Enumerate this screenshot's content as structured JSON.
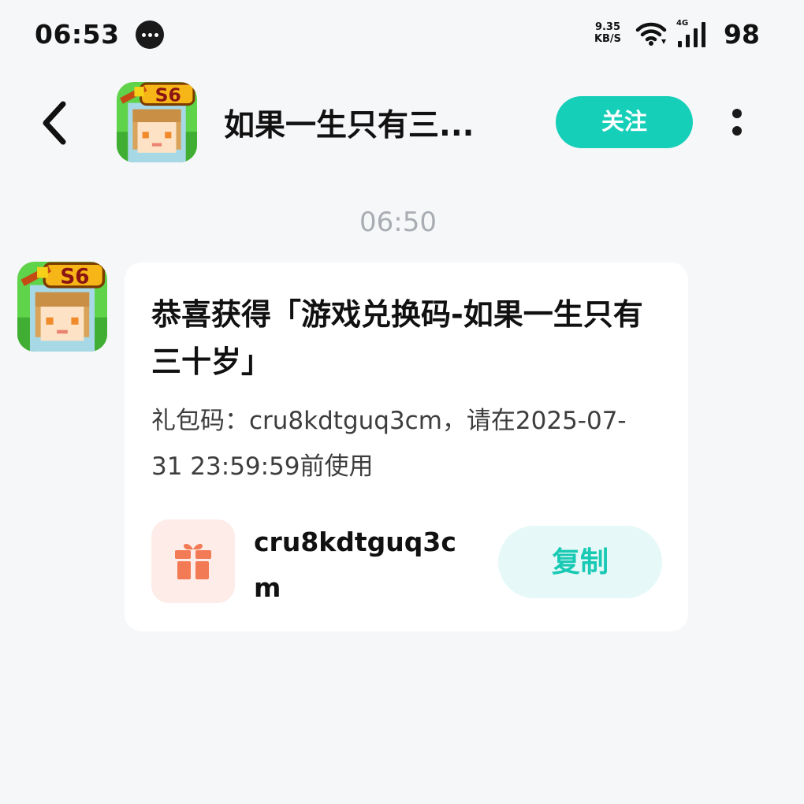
{
  "status_bar": {
    "time": "06:53",
    "net_speed_value": "9.35",
    "net_speed_unit": "KB/S",
    "network_type": "4G",
    "battery": "98",
    "icons": [
      "message-notification-icon",
      "wifi-icon",
      "cellular-signal-icon"
    ]
  },
  "header": {
    "title": "如果一生只有三...",
    "follow_label": "关注",
    "icons": [
      "back-icon",
      "more-icon"
    ]
  },
  "chat": {
    "timestamp": "06:50",
    "message": {
      "title": "恭喜获得「游戏兑换码-如果一生只有三十岁」",
      "body": "礼包码：cru8kdtguq3cm，请在2025-07-31 23:59:59前使用",
      "code": "cru8kdtguq3cm",
      "copy_label": "复制",
      "icon": "gift-icon"
    }
  },
  "colors": {
    "accent": "#16cfb8",
    "copy_bg": "#e6f8f7",
    "gift_bg": "#fdece8",
    "gift": "#f27a54",
    "background": "#f6f7f9"
  }
}
